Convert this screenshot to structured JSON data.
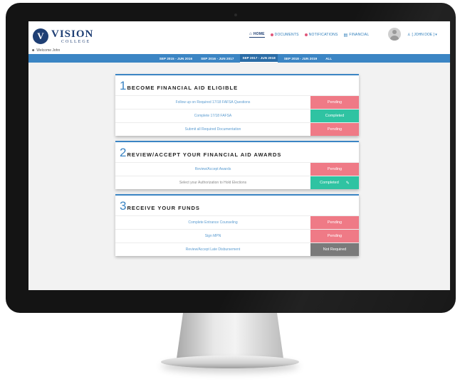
{
  "app": {
    "logo_letter": "V",
    "logo_title": "VISION",
    "logo_sub": "COLLEGE",
    "welcome": "Welcome John"
  },
  "nav": {
    "home": "HOME",
    "documents": "DOCUMENTS",
    "notifications": "NOTIFICATIONS",
    "financial": "FINANCIAL",
    "user": "[ JOHN DOE ] ▾"
  },
  "year_tabs": [
    {
      "label": "SEP 2015 - JUN 2016",
      "active": false
    },
    {
      "label": "SEP 2016 - JUN 2017",
      "active": false
    },
    {
      "label": "SEP 2017 - JUN 2018",
      "active": true
    },
    {
      "label": "SEP 2018 - JUN 2019",
      "active": false
    },
    {
      "label": "ALL",
      "active": false
    }
  ],
  "steps": [
    {
      "number": "1",
      "title": "BECOME FINANCIAL AID ELIGIBLE",
      "rows": [
        {
          "label": "Follow up on Required 17/18 FAFSA Questions",
          "status": "Pending"
        },
        {
          "label": "Complete 17/18 FAFSA",
          "status": "Completed"
        },
        {
          "label": "Submit all Required Documentation",
          "status": "Pending"
        }
      ]
    },
    {
      "number": "2",
      "title": "REVIEW/ACCEPT YOUR FINANCIAL AID AWARDS",
      "rows": [
        {
          "label": "Review/Accept Awards",
          "status": "Pending"
        },
        {
          "label": "Select your Authorization to Hold Elections",
          "status": "Completed"
        }
      ]
    },
    {
      "number": "3",
      "title": "RECEIVE YOUR FUNDS",
      "rows": [
        {
          "label": "Complete Entrance Counseling",
          "status": "Pending"
        },
        {
          "label": "Sign MPN",
          "status": "Pending"
        },
        {
          "label": "Review/Accept Late Disbursement",
          "status": "Not Required"
        }
      ]
    }
  ],
  "colors": {
    "primary": "#3b85c4",
    "navy": "#1f3f74",
    "pending": "#ef7a86",
    "completed": "#2fc3a2",
    "not_required": "#7a7a7a"
  }
}
